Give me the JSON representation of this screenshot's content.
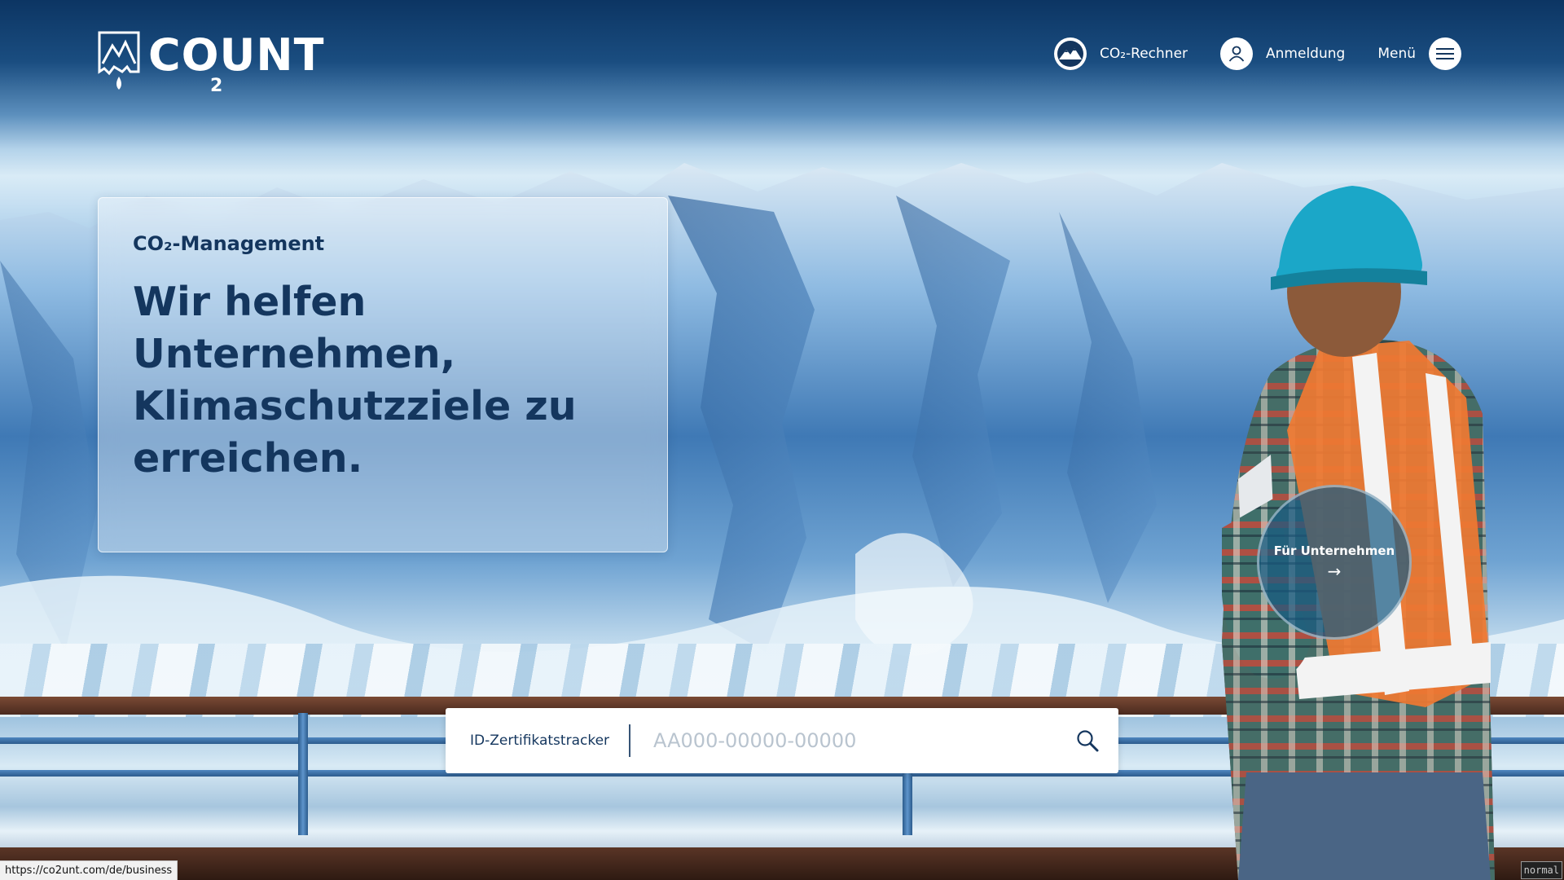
{
  "brand": {
    "name": "CO UNT",
    "name_main": "COUNT",
    "subscript": "2"
  },
  "nav": {
    "calculator_label": "CO₂-Rechner",
    "login_label": "Anmeldung",
    "menu_label": "Menü"
  },
  "hero": {
    "kicker": "CO₂-Management",
    "title": "Wir helfen Unternehmen, Klimaschutzziele zu erreichen."
  },
  "company_cta": {
    "label": "Für Unternehmen",
    "arrow": "→"
  },
  "tracker": {
    "label": "ID-Zertifikatstracker",
    "placeholder": "AA000-00000-00000",
    "value": ""
  },
  "browser": {
    "status_url": "https://co2unt.com/de/business",
    "mode": "normal"
  },
  "colors": {
    "primary": "#14365e",
    "header_bg": "#0c3563",
    "bubble": "#185a82",
    "white": "#ffffff"
  },
  "icons": {
    "calculator": "mountain-icon",
    "login": "user-icon",
    "menu": "hamburger-icon",
    "search": "search-icon",
    "logo": "glacier-logo-icon"
  }
}
